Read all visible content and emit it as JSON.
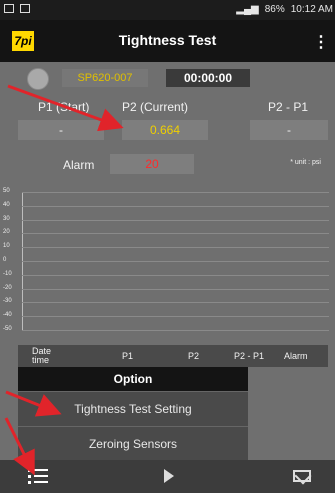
{
  "status_bar": {
    "time": "10:12 AM",
    "battery": "86%"
  },
  "app": {
    "logo_text": "7pi",
    "title": "Tightness Test"
  },
  "session": {
    "sensor_id": "SP620-007",
    "timer": "00:00:00"
  },
  "columns": {
    "p1": "P1 (Start)",
    "p2": "P2 (Current)",
    "diff": "P2 - P1"
  },
  "values": {
    "p1": "-",
    "p2": "0.664",
    "diff": "-"
  },
  "alarm": {
    "label": "Alarm",
    "value": "20",
    "unit_note": "* unit : psi"
  },
  "chart": {
    "ticks": [
      "50",
      "40",
      "30",
      "20",
      "10",
      "0",
      "-10",
      "-20",
      "-30",
      "-40",
      "-50"
    ]
  },
  "table": {
    "headers": [
      "Date time",
      "P1",
      "P2",
      "P2 - P1",
      "Alarm"
    ]
  },
  "option_menu": {
    "title": "Option",
    "items": [
      "Tightness Test Setting",
      "Zeroing Sensors"
    ]
  },
  "colors": {
    "accent_yellow": "#f0d000",
    "alarm_red": "#ff2a2a",
    "annotation_arrow": "#e1242a"
  }
}
